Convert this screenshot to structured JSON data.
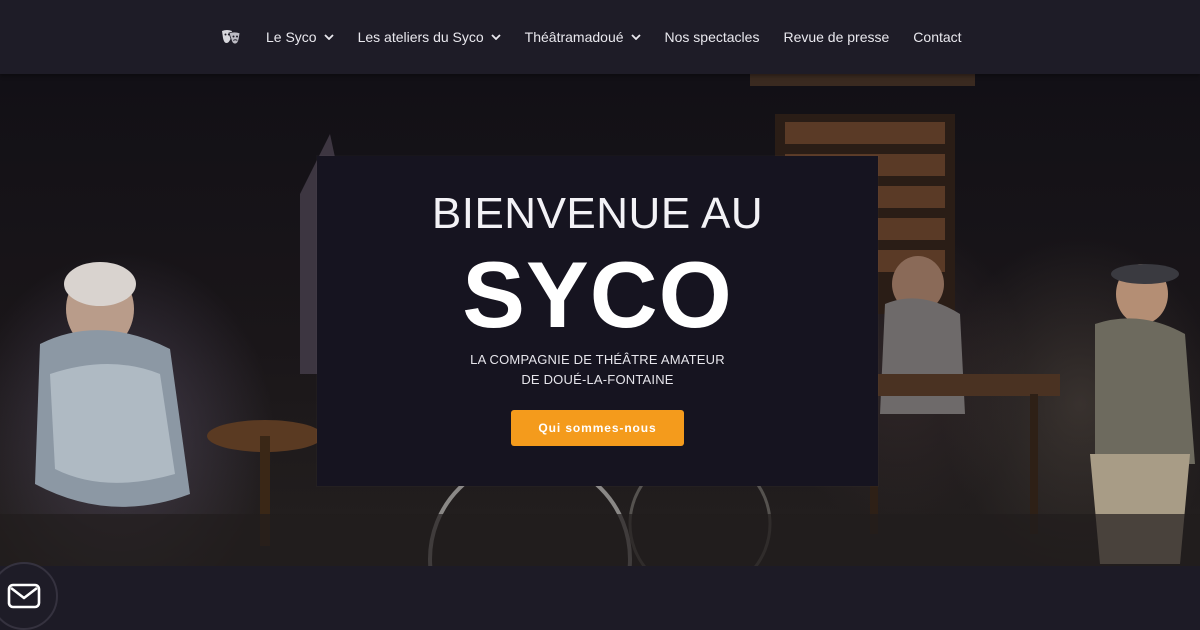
{
  "nav": {
    "logo_icon": "theater-masks-icon",
    "items": [
      {
        "label": "Le Syco",
        "has_dropdown": true
      },
      {
        "label": "Les ateliers du Syco",
        "has_dropdown": true
      },
      {
        "label": "Théâtramadoué",
        "has_dropdown": true
      },
      {
        "label": "Nos spectacles",
        "has_dropdown": false
      },
      {
        "label": "Revue de presse",
        "has_dropdown": false
      },
      {
        "label": "Contact",
        "has_dropdown": false
      }
    ]
  },
  "hero": {
    "kicker": "BIENVENUE AU",
    "title": "SYCO",
    "subtitle_line1": "LA COMPAGNIE DE THÉÂTRE AMATEUR",
    "subtitle_line2": "DE DOUÉ-LA-FONTAINE",
    "cta_label": "Qui sommes-nous"
  },
  "contact_fab": {
    "icon": "envelope-icon"
  },
  "colors": {
    "background": "#1d1b26",
    "navbar": "#1e1c27",
    "card": "#161420",
    "accent": "#f49b1c",
    "text": "#ffffff"
  }
}
